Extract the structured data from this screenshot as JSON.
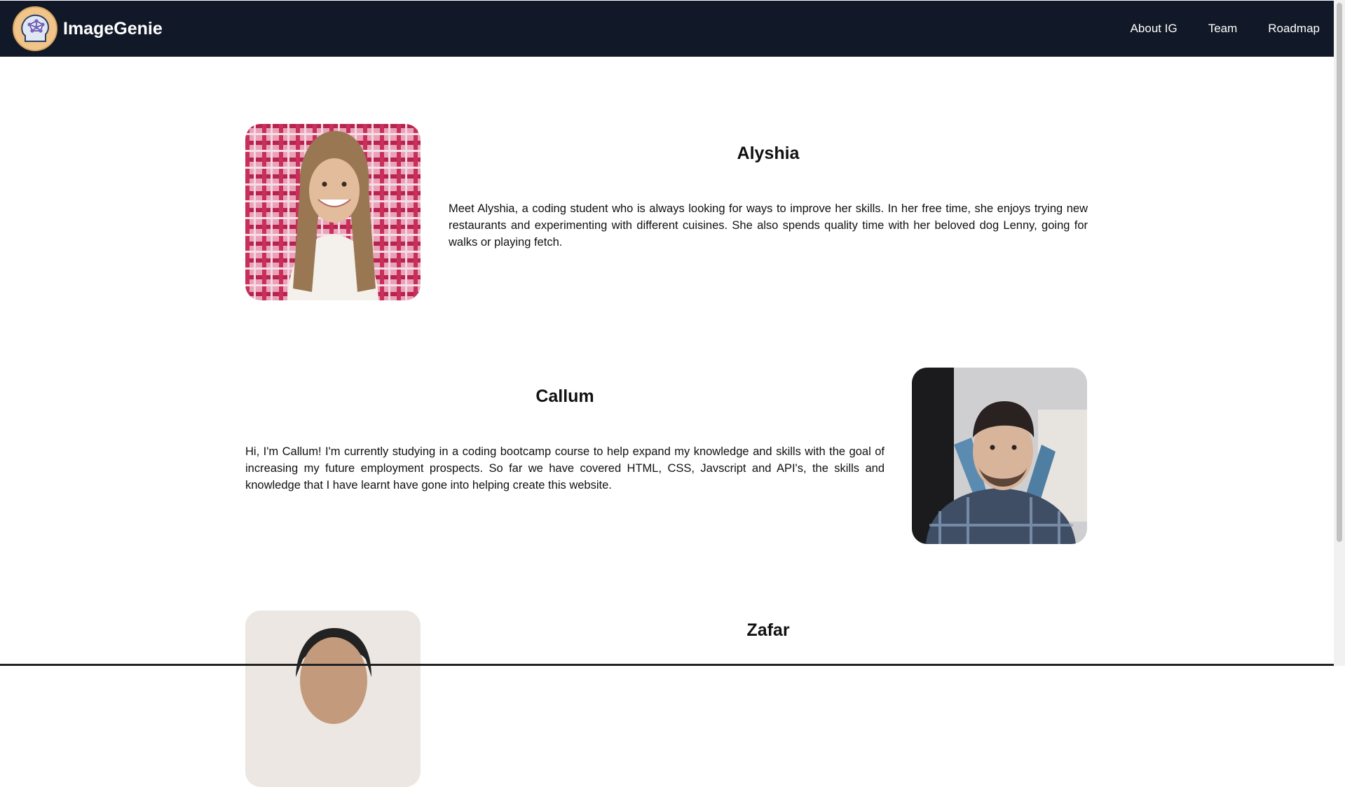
{
  "header": {
    "brand": "ImageGenie",
    "nav": [
      "About IG",
      "Team",
      "Roadmap"
    ]
  },
  "members": [
    {
      "name": "Alyshia",
      "bio": "Meet Alyshia, a coding student who is always looking for ways to improve her skills. In her free time, she enjoys trying new restaurants and experimenting with different cuisines. She also spends quality time with her beloved dog Lenny, going for walks or playing fetch."
    },
    {
      "name": "Callum",
      "bio": "Hi, I'm Callum! I'm currently studying in a coding bootcamp course to help expand my knowledge and skills with the goal of increasing my future employment prospects. So far we have covered HTML, CSS, Javscript and API's, the skills and knowledge that I have learnt have gone into helping create this website."
    },
    {
      "name": "Zafar",
      "bio": ""
    }
  ],
  "colors": {
    "navbar_bg": "#111827",
    "logo_bg": "#f1c48a"
  }
}
